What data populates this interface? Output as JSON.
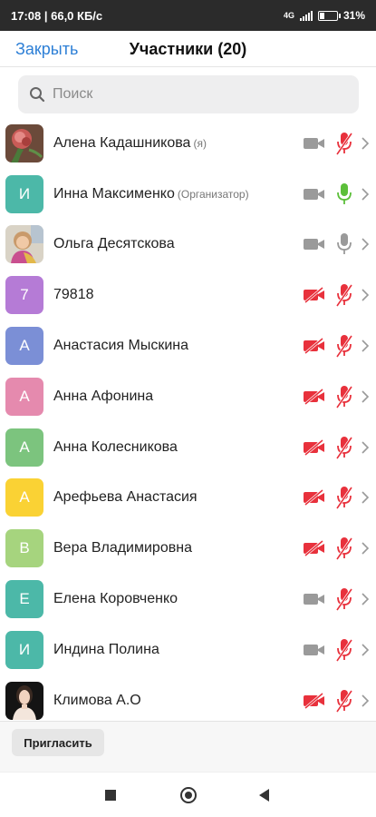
{
  "status_bar": {
    "time_speed": "17:08 | 66,0 КБ/с",
    "network": "4G",
    "battery": "31",
    "battery_level": 0.31
  },
  "header": {
    "close_label": "Закрыть",
    "title": "Участники (20)"
  },
  "search": {
    "placeholder": "Поиск"
  },
  "participants": [
    {
      "name": "Алена Кадашникова",
      "role": "(я)",
      "avatar": "photo-rose",
      "video": "on",
      "mic": "muted"
    },
    {
      "name": "Инна Максименко",
      "role": "(Организатор)",
      "avatar_letter": "И",
      "avatar_color": "#4cb8a8",
      "video": "on",
      "mic": "active"
    },
    {
      "name": "Ольга Десятскова",
      "role": "",
      "avatar": "photo-woman",
      "video": "on",
      "mic": "on"
    },
    {
      "name": "79818",
      "role": "",
      "avatar_letter": "7",
      "avatar_color": "#b57bd6",
      "video": "off",
      "mic": "muted"
    },
    {
      "name": "Анастасия Мыскина",
      "role": "",
      "avatar_letter": "А",
      "avatar_color": "#7b8fd6",
      "video": "off",
      "mic": "muted"
    },
    {
      "name": "Анна Афонина",
      "role": "",
      "avatar_letter": "А",
      "avatar_color": "#e58aae",
      "video": "off",
      "mic": "muted"
    },
    {
      "name": "Анна Колесникова",
      "role": "",
      "avatar_letter": "А",
      "avatar_color": "#7cc47e",
      "video": "off",
      "mic": "muted"
    },
    {
      "name": "Арефьева Анастасия",
      "role": "",
      "avatar_letter": "А",
      "avatar_color": "#fad234",
      "video": "off",
      "mic": "muted"
    },
    {
      "name": "Вера Владимировна",
      "role": "",
      "avatar_letter": "В",
      "avatar_color": "#a6d47e",
      "video": "off",
      "mic": "muted"
    },
    {
      "name": "Елена Коровченко",
      "role": "",
      "avatar_letter": "Е",
      "avatar_color": "#4cb8a8",
      "video": "on",
      "mic": "muted"
    },
    {
      "name": "Индина Полина",
      "role": "",
      "avatar_letter": "И",
      "avatar_color": "#4cb8a8",
      "video": "on",
      "mic": "muted"
    },
    {
      "name": "Климова А.О",
      "role": "",
      "avatar": "photo-portrait",
      "video": "off",
      "mic": "muted"
    }
  ],
  "bottom": {
    "invite_label": "Пригласить"
  },
  "colors": {
    "accent": "#2d7fd6",
    "muted_red": "#e8313c",
    "active_green": "#5cbf3a",
    "icon_grey": "#9a9a9a"
  },
  "icons": {
    "camera_on": "camera-icon",
    "camera_off": "camera-off-icon",
    "mic_on": "mic-icon",
    "mic_muted": "mic-muted-icon",
    "chevron": "chevron-right-icon"
  }
}
